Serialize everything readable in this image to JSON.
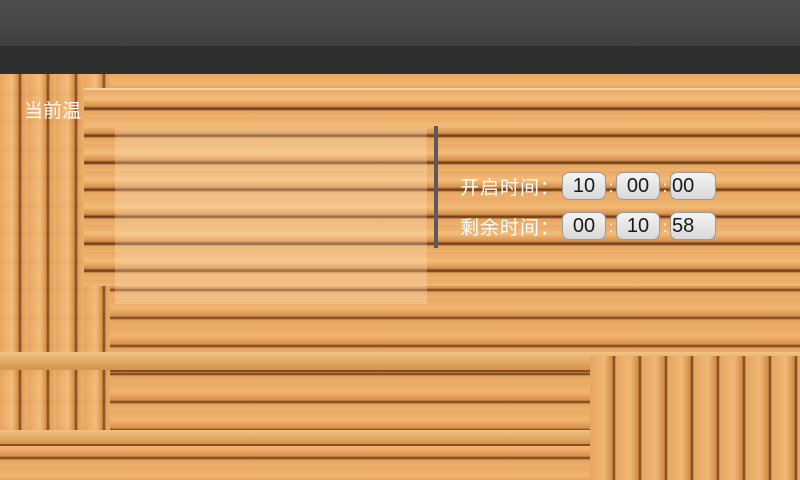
{
  "status": {
    "label": "当前温"
  },
  "timers": {
    "open_time": {
      "label": "开启时间：",
      "h": "10",
      "m": "00",
      "s": "00"
    },
    "remaining_time": {
      "label": "剩余时间：",
      "h": "00",
      "m": "10",
      "s": "58"
    },
    "separator": ":"
  }
}
